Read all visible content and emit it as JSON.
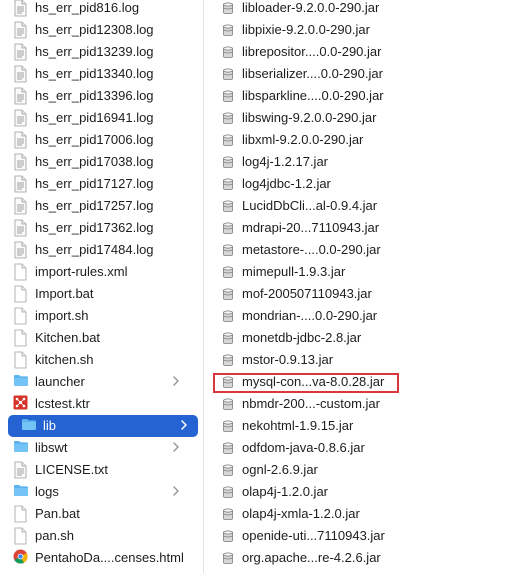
{
  "left_column": {
    "items": [
      {
        "name": "hs_err_pid816.log",
        "kind": "file"
      },
      {
        "name": "hs_err_pid12308.log",
        "kind": "file"
      },
      {
        "name": "hs_err_pid13239.log",
        "kind": "file"
      },
      {
        "name": "hs_err_pid13340.log",
        "kind": "file"
      },
      {
        "name": "hs_err_pid13396.log",
        "kind": "file"
      },
      {
        "name": "hs_err_pid16941.log",
        "kind": "file"
      },
      {
        "name": "hs_err_pid17006.log",
        "kind": "file"
      },
      {
        "name": "hs_err_pid17038.log",
        "kind": "file"
      },
      {
        "name": "hs_err_pid17127.log",
        "kind": "file"
      },
      {
        "name": "hs_err_pid17257.log",
        "kind": "file"
      },
      {
        "name": "hs_err_pid17362.log",
        "kind": "file"
      },
      {
        "name": "hs_err_pid17484.log",
        "kind": "file"
      },
      {
        "name": "import-rules.xml",
        "kind": "doc"
      },
      {
        "name": "Import.bat",
        "kind": "doc"
      },
      {
        "name": "import.sh",
        "kind": "doc"
      },
      {
        "name": "Kitchen.bat",
        "kind": "doc"
      },
      {
        "name": "kitchen.sh",
        "kind": "doc"
      },
      {
        "name": "launcher",
        "kind": "folder"
      },
      {
        "name": "lcstest.ktr",
        "kind": "ktr"
      },
      {
        "name": "lib",
        "kind": "folder",
        "selected": true
      },
      {
        "name": "libswt",
        "kind": "folder"
      },
      {
        "name": "LICENSE.txt",
        "kind": "file"
      },
      {
        "name": "logs",
        "kind": "folder"
      },
      {
        "name": "Pan.bat",
        "kind": "doc"
      },
      {
        "name": "pan.sh",
        "kind": "doc"
      },
      {
        "name": "PentahoDa....censes.html",
        "kind": "chrome"
      }
    ]
  },
  "right_column": {
    "items": [
      "libloader-9.2.0.0-290.jar",
      "libpixie-9.2.0.0-290.jar",
      "librepositor....0.0-290.jar",
      "libserializer....0.0-290.jar",
      "libsparkline....0.0-290.jar",
      "libswing-9.2.0.0-290.jar",
      "libxml-9.2.0.0-290.jar",
      "log4j-1.2.17.jar",
      "log4jdbc-1.2.jar",
      "LucidDbCli...al-0.9.4.jar",
      "mdrapi-20...7110943.jar",
      "metastore-....0.0-290.jar",
      "mimepull-1.9.3.jar",
      "mof-200507110943.jar",
      "mondrian-....0.0-290.jar",
      "monetdb-jdbc-2.8.jar",
      "mstor-0.9.13.jar",
      "mysql-con...va-8.0.28.jar",
      "nbmdr-200...-custom.jar",
      "nekohtml-1.9.15.jar",
      "odfdom-java-0.8.6.jar",
      "ognl-2.6.9.jar",
      "olap4j-1.2.0.jar",
      "olap4j-xmla-1.2.0.jar",
      "openide-uti...7110943.jar",
      "org.apache...re-4.2.6.jar"
    ],
    "highlighted": "mysql-con...va-8.0.28.jar"
  },
  "colors": {
    "selection": "#2463d1",
    "folder": "#5ab4f0",
    "highlight_border": "#d9363e"
  }
}
